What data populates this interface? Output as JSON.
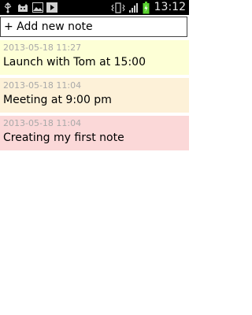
{
  "status_bar": {
    "time": "13:12",
    "left_icons": [
      "usb-icon",
      "cat-icon",
      "image-icon",
      "play-icon"
    ],
    "right_icons": [
      "vibrate-icon",
      "signal-icon",
      "battery-charging-icon"
    ]
  },
  "add_note": {
    "label": "+ Add new note"
  },
  "notes": [
    {
      "timestamp": "2013-05-18 11:27",
      "text": "Launch with Tom at 15:00",
      "color": "#fdffd6"
    },
    {
      "timestamp": "2013-05-18 11:04",
      "text": "Meeting at 9:00 pm",
      "color": "#fdf1d8"
    },
    {
      "timestamp": "2013-05-18 11:04",
      "text": "Creating my first note",
      "color": "#fbd8d8"
    }
  ]
}
